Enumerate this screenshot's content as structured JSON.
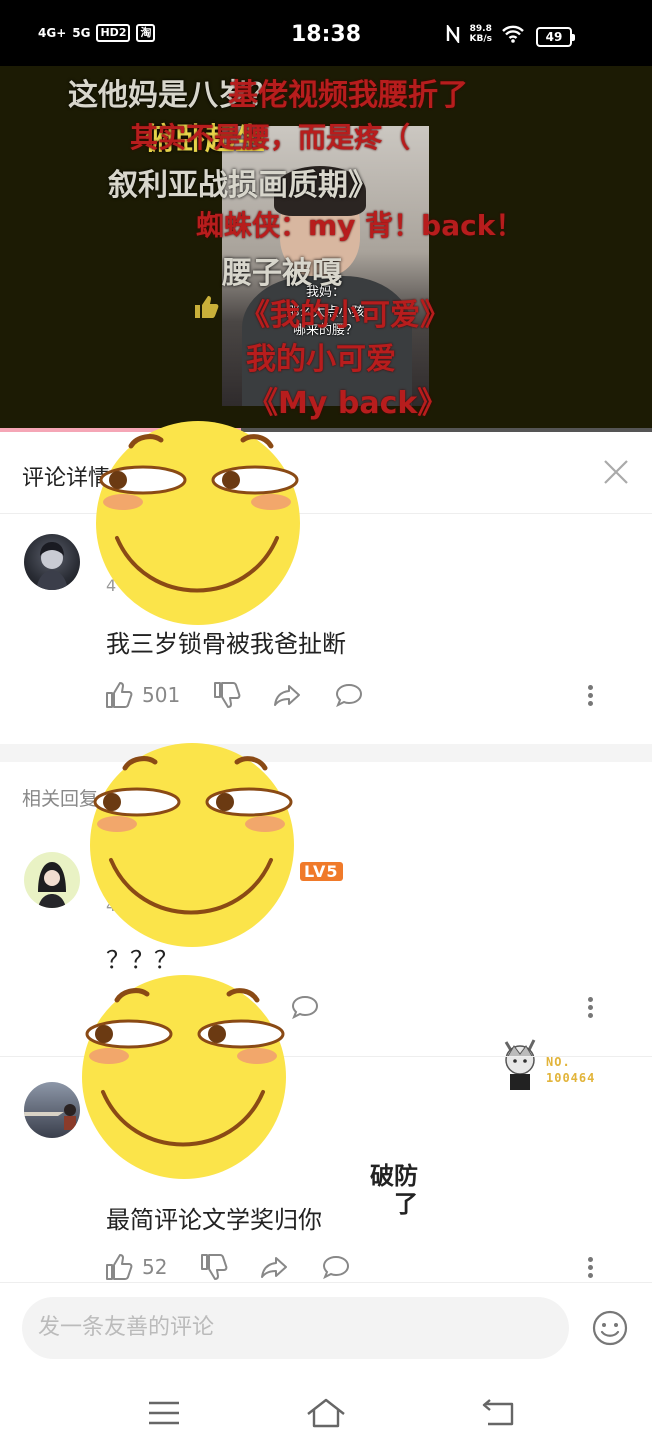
{
  "status_bar": {
    "network1": "4G+",
    "network2": "5G",
    "hd_label": "HD",
    "hd_sub": "2",
    "app_badge": "淘",
    "time": "18:38",
    "speed_value": "89.8",
    "speed_unit": "KB/s",
    "battery": "49"
  },
  "video": {
    "danmu": [
      "这他妈是八岁？",
      "基佬视频我腰折了",
      "俯卧起坐",
      "其实不是腰，而是疼（",
      "叙利亚战损画质期》",
      "蜘蛛侠：my 背！back！",
      "腰子被嘎",
      "《我的小可爱》",
      "我的小可爱",
      "《My back》"
    ],
    "frame_caption_1": "我妈：",
    "frame_caption_2": "那么大点小孩",
    "frame_caption_3": "哪来的腰？",
    "progress": 0.37
  },
  "panel": {
    "title": "评论详情",
    "close_icon": "close-icon"
  },
  "main_comment": {
    "meta": "4",
    "text": "我三岁锁骨被我爸扯断",
    "likes": "501",
    "nft_label": "NO.\n100464"
  },
  "replies_label": "相关回复",
  "replies": [
    {
      "meta": "4",
      "level": "LV5",
      "text": "？？？",
      "likes": ""
    },
    {
      "meta": "",
      "text": "最简评论文学奖归你",
      "sticker_text": "破防了",
      "likes": "52"
    }
  ],
  "input": {
    "placeholder": "发一条友善的评论"
  },
  "colors": {
    "emoji_yellow": "#fbe44a",
    "danmu_red": "#b71d1d",
    "level_orange": "#f07a2a"
  }
}
